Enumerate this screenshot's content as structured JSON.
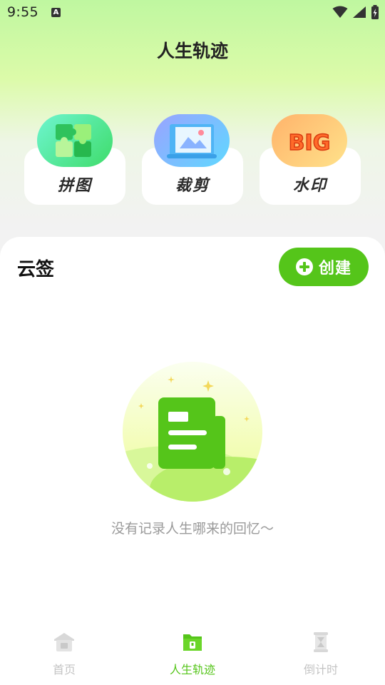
{
  "status_bar": {
    "time": "9:55",
    "notif_letter": "A"
  },
  "header": {
    "title": "人生轨迹"
  },
  "tools": [
    {
      "label": "拼图",
      "icon": "puzzle-icon"
    },
    {
      "label": "裁剪",
      "icon": "crop-icon"
    },
    {
      "label": "水印",
      "icon": "watermark-big-icon",
      "icon_text": "BIG"
    }
  ],
  "section": {
    "title": "云签",
    "create_label": "创建"
  },
  "empty_state": {
    "text": "没有记录人生哪来的回忆～",
    "icon": "empty-document-icon"
  },
  "tabbar": {
    "tabs": [
      {
        "label": "首页",
        "icon": "home-icon",
        "active": false
      },
      {
        "label": "人生轨迹",
        "icon": "folder-icon",
        "active": true
      },
      {
        "label": "倒计时",
        "icon": "hourglass-icon",
        "active": false
      }
    ]
  },
  "colors": {
    "accent": "#55c51a",
    "muted": "#c4c4c4"
  }
}
